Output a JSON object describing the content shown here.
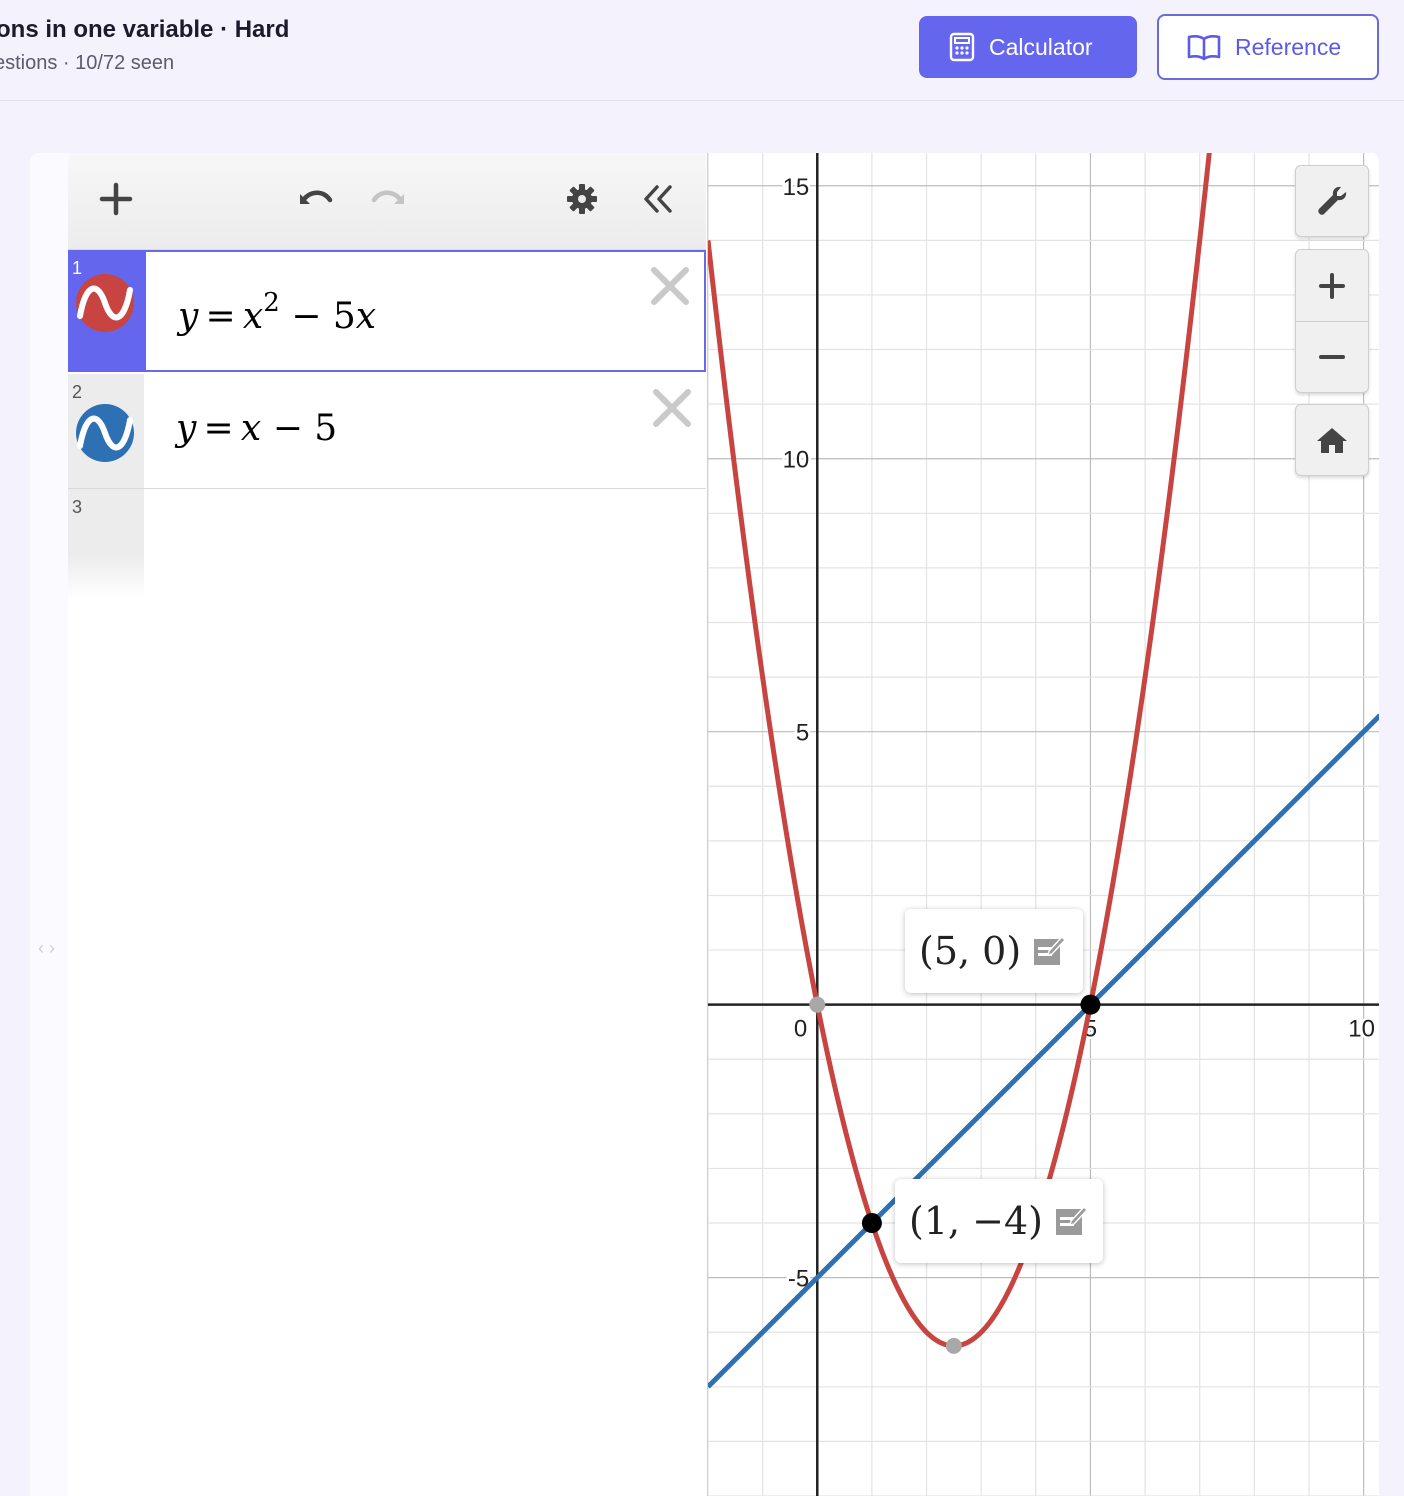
{
  "header": {
    "title": "ons in one variable · Hard",
    "subtitle": "estions · 10/72 seen",
    "calculator_label": "Calculator",
    "reference_label": "Reference"
  },
  "expressions": [
    {
      "num": "1",
      "lhs": "y",
      "eq": "=",
      "x": "x",
      "exp": "2",
      "rest": "− 5",
      "var": "x",
      "color": "#c74440",
      "selected": true
    },
    {
      "num": "2",
      "lhs": "y",
      "eq": "=",
      "x": "x",
      "rest": "− 5",
      "color": "#2d70b3",
      "selected": false
    },
    {
      "num": "3"
    }
  ],
  "graph": {
    "x_ticks": [
      "0",
      "5",
      "10"
    ],
    "y_ticks": [
      "15",
      "10",
      "5",
      "-5"
    ],
    "points": [
      {
        "label": "(5, 0)",
        "x": 5,
        "y": 0
      },
      {
        "label": "(1, −4)",
        "x": 1,
        "y": -4
      }
    ]
  },
  "chart_data": {
    "type": "line",
    "series": [
      {
        "expression": "y = x^2 - 5x",
        "color": "#c74440"
      },
      {
        "expression": "y = x - 5",
        "color": "#2d70b3"
      }
    ],
    "xlim": [
      -2,
      10.3
    ],
    "ylim": [
      -9,
      15.6
    ],
    "highlighted_points": [
      [
        0,
        0
      ],
      [
        5,
        0
      ],
      [
        1,
        -4
      ],
      [
        2.5,
        -6.25
      ]
    ],
    "labeled_points": [
      [
        5,
        0
      ],
      [
        1,
        -4
      ]
    ],
    "grid": true
  }
}
